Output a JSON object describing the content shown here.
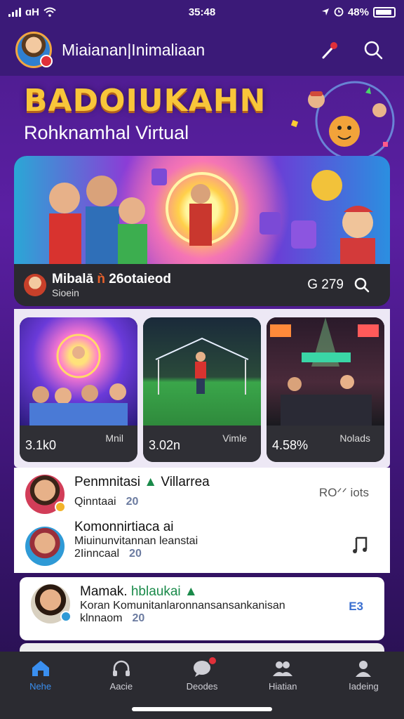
{
  "status_bar": {
    "carrier": "ɑH",
    "time": "35:48",
    "battery_pct": "48%"
  },
  "header": {
    "title": "Miaianan|Inimaliaan",
    "mic_icon": "microphone-icon",
    "search_icon": "search-icon"
  },
  "hero": {
    "title": "BADOIUKAHN",
    "subtitle": "Rohknamhal Virtual"
  },
  "banner": {
    "title_main": "Mibalā",
    "title_accent": "ǹ",
    "title_rest": "26otaieod",
    "subtitle": "Sioein",
    "count": "G 279"
  },
  "thumbnails": [
    {
      "label": "Mnil",
      "stat": "3.1k0"
    },
    {
      "label": "Vimle",
      "stat": "3.02n"
    },
    {
      "label": "Nolads",
      "stat": "4.58%"
    }
  ],
  "list": [
    {
      "title": "Penmnitasi",
      "title_hl": "Villarrea",
      "meta_text": "Qinntaai",
      "meta_pill": "20",
      "right": "ROᐟᐟ iots"
    },
    {
      "title": "Komonnirtiaca ai",
      "body": "Miuinunvitannan leanstai",
      "meta_text": "2Iinncaal",
      "meta_pill": "20"
    }
  ],
  "post": {
    "title": "Mamak.",
    "title_hl": "hblaukai",
    "body": "Koran Komunitanlaronnansansankanisan",
    "meta_text": "klnnaom",
    "meta_pill": "20",
    "right": "E3"
  },
  "tabs": [
    {
      "label": "Nehe",
      "icon": "home-icon",
      "active": true
    },
    {
      "label": "Aacie",
      "icon": "headphones-icon",
      "active": false
    },
    {
      "label": "Deodes",
      "icon": "chat-icon",
      "active": false
    },
    {
      "label": "Hiatian",
      "icon": "people-icon",
      "active": false
    },
    {
      "label": "Iadeing",
      "icon": "profile-icon",
      "active": false
    }
  ],
  "colors": {
    "accent": "#3a8ff0",
    "hero_title": "#f8c63a",
    "background": "#4a1c8a",
    "badge": "#e0303a"
  }
}
